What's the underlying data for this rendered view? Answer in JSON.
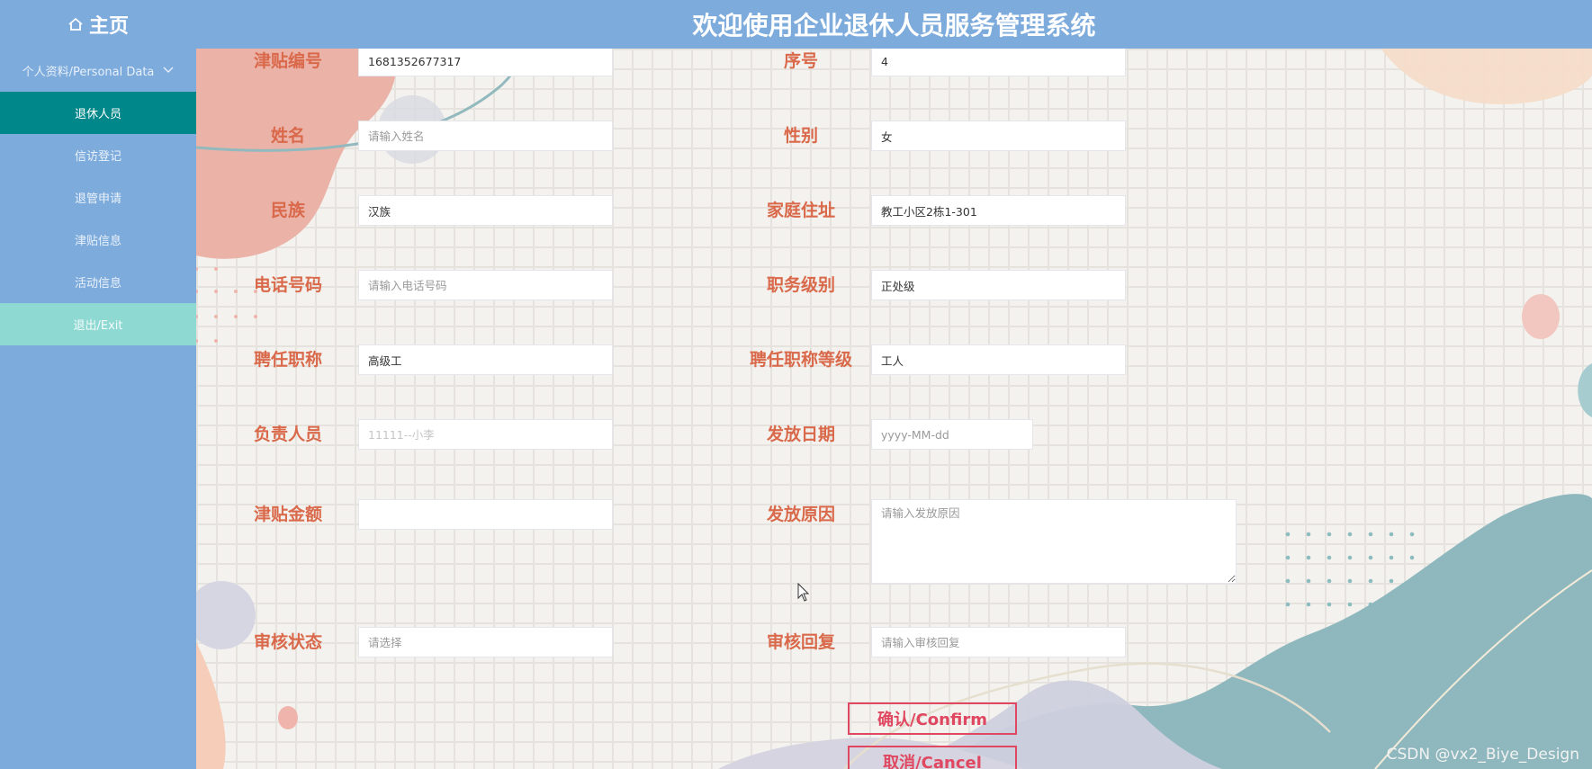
{
  "header": {
    "home_label": "主页",
    "system_title": "欢迎使用企业退休人员服务管理系统"
  },
  "sidebar": {
    "group_label": "个人资料/Personal Data",
    "items": [
      {
        "label": "退休人员"
      },
      {
        "label": "信访登记"
      },
      {
        "label": "退管申请"
      },
      {
        "label": "津贴信息"
      },
      {
        "label": "活动信息"
      },
      {
        "label": "退出/Exit"
      }
    ]
  },
  "form": {
    "allowance_no": {
      "label": "津贴编号",
      "value": "1681352677317"
    },
    "serial_no": {
      "label": "序号",
      "value": "4"
    },
    "name": {
      "label": "姓名",
      "placeholder": "请输入姓名"
    },
    "gender": {
      "label": "性别",
      "value": "女"
    },
    "ethnicity": {
      "label": "民族",
      "value": "汉族"
    },
    "address": {
      "label": "家庭住址",
      "value": "教工小区2栋1-301"
    },
    "phone": {
      "label": "电话号码",
      "placeholder": "请输入电话号码"
    },
    "job_level": {
      "label": "职务级别",
      "value": "正处级"
    },
    "title": {
      "label": "聘任职称",
      "value": "高级工"
    },
    "title_grade": {
      "label": "聘任职称等级",
      "value": "工人"
    },
    "manager": {
      "label": "负责人员",
      "placeholder": "11111--小李"
    },
    "issue_date": {
      "label": "发放日期",
      "placeholder": "yyyy-MM-dd"
    },
    "amount": {
      "label": "津贴金额",
      "value": ""
    },
    "issue_reason": {
      "label": "发放原因",
      "placeholder": "请输入发放原因"
    },
    "audit_status": {
      "label": "审核状态",
      "placeholder": "请选择"
    },
    "audit_reply": {
      "label": "审核回复",
      "placeholder": "请输入审核回复"
    }
  },
  "buttons": {
    "confirm": "确认/Confirm",
    "cancel": "取消/Cancel"
  },
  "watermark": "CSDN @vx2_Biye_Design"
}
